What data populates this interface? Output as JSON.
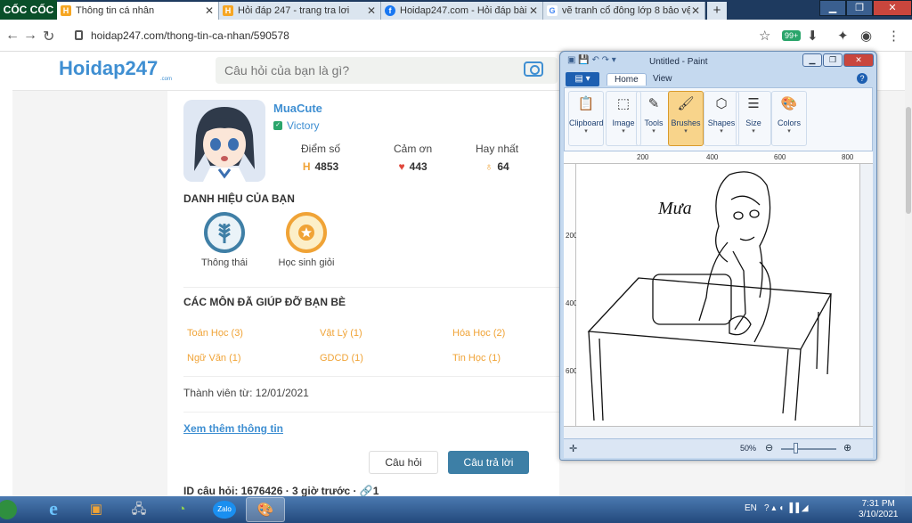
{
  "browser": {
    "logo": "CỐC CỐC",
    "tabs": [
      {
        "title": "Thông tin cá nhân",
        "favicon": "hoidap-favicon",
        "active": true
      },
      {
        "title": "Hỏi đáp 247 - trang tra lơi",
        "favicon": "hoidap-favicon",
        "active": false
      },
      {
        "title": "Hoidap247.com - Hỏi đáp bài",
        "favicon": "facebook-favicon",
        "active": false
      },
      {
        "title": "vẽ tranh cổ đông lớp 8 bảo vệ",
        "favicon": "google-favicon",
        "active": false
      }
    ],
    "new_tab": "+",
    "url": "hoidap247.com/thong-tin-ca-nhan/590578",
    "badge": "99+"
  },
  "site": {
    "logo": "Hoidap247",
    "logo_sub": ".com",
    "search_placeholder": "Câu hỏi của bạn là gì?"
  },
  "profile": {
    "username": "MuaCute",
    "rank": "Victory",
    "stats": [
      {
        "label": "Điểm số",
        "value": "4853",
        "icon": "hoidap-h-icon",
        "color": "#f0a336"
      },
      {
        "label": "Cảm ơn",
        "value": "443",
        "icon": "heart-icon",
        "color": "#e0473b"
      },
      {
        "label": "Hay nhất",
        "value": "64",
        "icon": "medal-icon",
        "color": "#f0a336"
      }
    ],
    "titles_heading": "DANH HIỆU CỦA BẠN",
    "badges": [
      {
        "label": "Thông thái",
        "icon": "wheat-badge-icon",
        "color": "#3f7fa6"
      },
      {
        "label": "Học sinh giỏi",
        "icon": "gold-medal-badge-icon",
        "color": "#f0a336"
      }
    ],
    "subjects_heading": "CÁC MÔN ĐÃ GIÚP ĐỠ BẠN BÈ",
    "subjects": [
      "Toán Học (3)",
      "Vật Lý (1)",
      "Hóa Học (2)",
      "Ngữ Văn (1)",
      "GDCD (1)",
      "Tin Học (1)"
    ],
    "member_since": "Thành viên từ: 12/01/2021",
    "more_link": "Xem thêm thông tin"
  },
  "actions": {
    "ask": "Câu hỏi",
    "answer": "Câu trả lời"
  },
  "question_meta": "ID câu hỏi: 1676426 · 3 giờ trước · 🔗1",
  "paint": {
    "title": "Untitled - Paint",
    "tabs": [
      "Home",
      "View"
    ],
    "groups": [
      {
        "label": "Clipboard",
        "icon": "clipboard-icon",
        "selected": false
      },
      {
        "label": "Image",
        "icon": "image-select-icon",
        "selected": false
      },
      {
        "label": "Tools",
        "icon": "tools-icon",
        "selected": false
      },
      {
        "label": "Brushes",
        "icon": "brush-icon",
        "selected": true
      },
      {
        "label": "Shapes",
        "icon": "shapes-icon",
        "selected": false
      },
      {
        "label": "Size",
        "icon": "size-icon",
        "selected": false
      },
      {
        "label": "Colors",
        "icon": "colors-icon",
        "selected": false
      }
    ],
    "ruler_top": [
      "200",
      "400",
      "600",
      "800"
    ],
    "ruler_left": [
      "200",
      "400",
      "600"
    ],
    "canvas_text": "Mưa",
    "zoom": "50%"
  },
  "taskbar": {
    "language": "EN",
    "time": "7:31 PM",
    "date": "3/10/2021",
    "apps": [
      "ie-icon",
      "media-player-icon",
      "network-icon",
      "coc-coc-icon",
      "zalo-icon",
      "paint-icon"
    ],
    "zalo_label": "Zalo"
  }
}
